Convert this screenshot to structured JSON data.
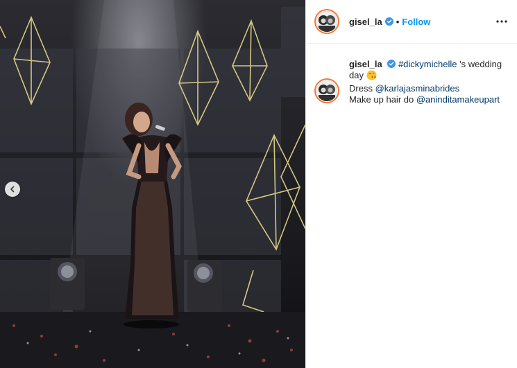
{
  "media": {
    "image_icon": "concert-stage-photo",
    "prev_icon": "chevron-left-icon"
  },
  "header": {
    "username": "gisel_la",
    "separator": "•",
    "follow_label": "Follow",
    "verified_icon": "verified-badge-icon",
    "more_icon": "more-options-icon"
  },
  "caption": {
    "username": "gisel_la",
    "hashtag": "#dickymichelle",
    "text_after_hashtag": " 's wedding day",
    "emoji": "face-blowing-kiss",
    "line2_prefix": "Dress ",
    "line2_mention": "@karlajasminabrides",
    "line3_prefix": "Make up hair do ",
    "line3_mention": "@aninditamakeupart"
  },
  "colors": {
    "link_blue": "#0095f6",
    "mention": "#00376b",
    "verified": "#3897f0",
    "neon": "#e6d98a"
  }
}
